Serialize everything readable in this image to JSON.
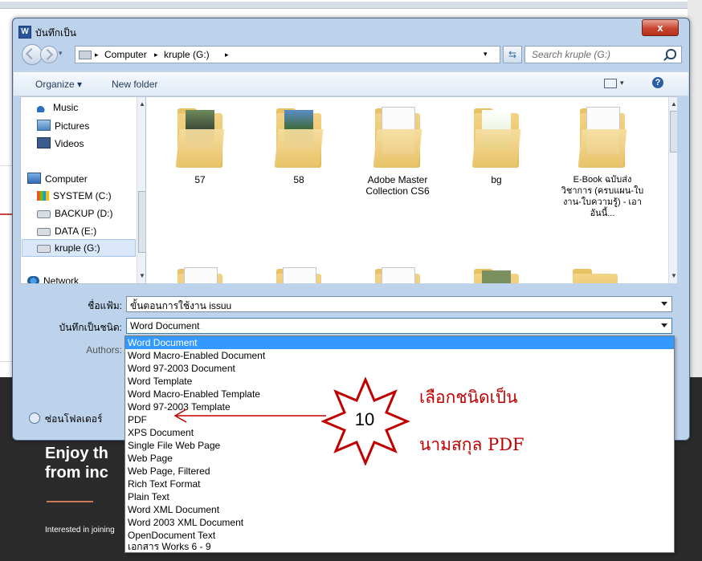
{
  "dialog": {
    "title": "บันทึกเป็น",
    "title_icon": "W",
    "close_label": "x"
  },
  "address": {
    "crumbs": [
      "Computer",
      "kruple (G:)"
    ],
    "separator": "▸"
  },
  "search": {
    "placeholder": "Search kruple (G:)"
  },
  "toolbar": {
    "organize": "Organize ▾",
    "new_folder": "New folder",
    "help": "?"
  },
  "navpane": {
    "items": [
      {
        "label": "Music",
        "icon": "music-icon"
      },
      {
        "label": "Pictures",
        "icon": "pictures-icon"
      },
      {
        "label": "Videos",
        "icon": "videos-icon"
      },
      {
        "label": "Computer",
        "icon": "computer-icon"
      },
      {
        "label": "SYSTEM (C:)",
        "icon": "system-drive-icon"
      },
      {
        "label": "BACKUP (D:)",
        "icon": "drive-icon"
      },
      {
        "label": "DATA (E:)",
        "icon": "drive-icon"
      },
      {
        "label": "kruple (G:)",
        "icon": "drive-icon",
        "selected": true
      },
      {
        "label": "Network",
        "icon": "network-icon"
      }
    ]
  },
  "files": {
    "items": [
      {
        "label": "57"
      },
      {
        "label": "58"
      },
      {
        "label": "Adobe Master Collection CS6"
      },
      {
        "label": "bg"
      },
      {
        "label": "E-Book ฉบับส่งวิชาการ (ครบแผน-ใบงาน-ใบความรู้) - เอาอันนี้..."
      }
    ]
  },
  "form": {
    "filename_label": "ชื่อแฟ้ม:",
    "filename_value": "ขั้นตอนการใช้งาน issuu",
    "savetype_label": "บันทึกเป็นชนิด:",
    "savetype_value": "Word Document",
    "authors_label": "Authors:",
    "hide_folders": "ซ่อนโฟลเดอร์"
  },
  "savetype_options": [
    "Word Document",
    "Word Macro-Enabled Document",
    "Word 97-2003 Document",
    "Word Template",
    "Word Macro-Enabled Template",
    "Word 97-2003 Template",
    "PDF",
    "XPS Document",
    "Single File Web Page",
    "Web Page",
    "Web Page, Filtered",
    "Rich Text Format",
    "Plain Text",
    "Word XML Document",
    "Word 2003 XML Document",
    "OpenDocument Text",
    "เอกสาร Works 6 - 9"
  ],
  "background": {
    "hero_line1": "Enjoy th",
    "hero_line2": "from inc",
    "footer_text": "Interested in joining"
  },
  "annotation": {
    "step": "10",
    "line1": "เลือกชนิดเป็น",
    "line2": "นามสกุล PDF",
    "color": "#c00000"
  }
}
